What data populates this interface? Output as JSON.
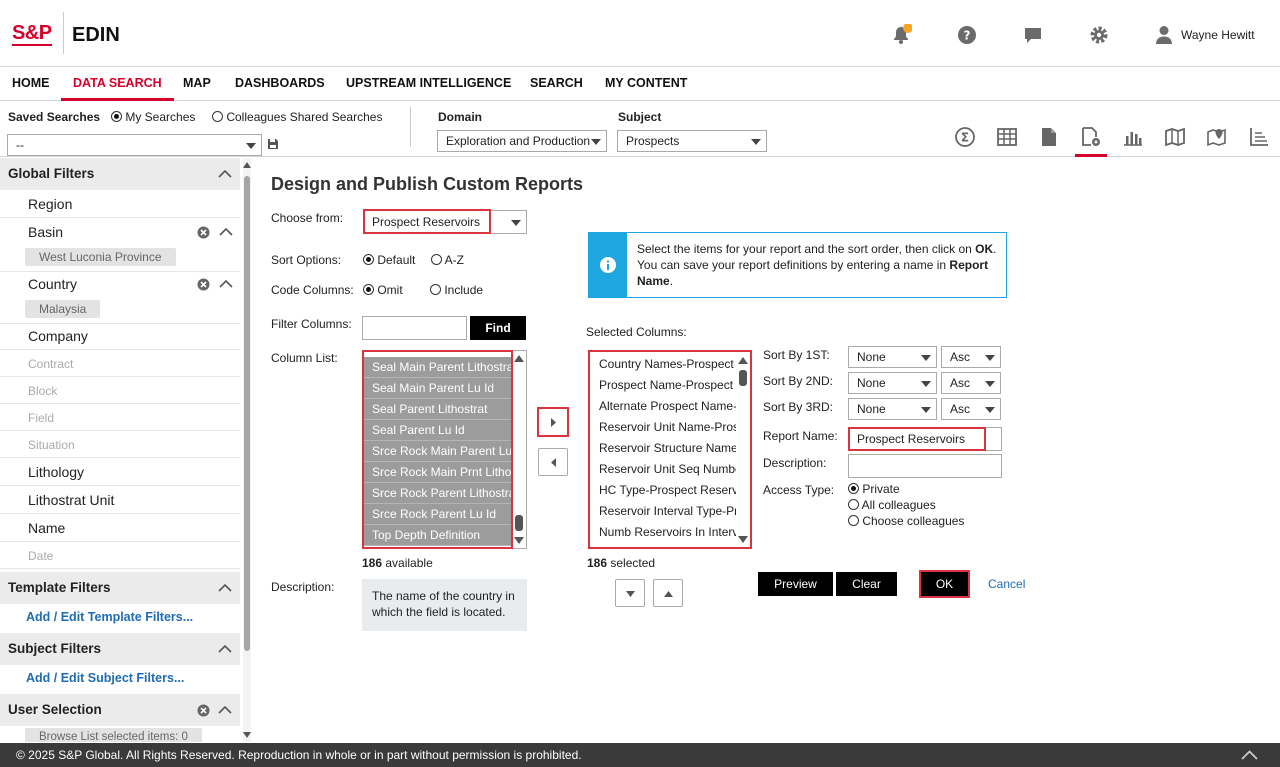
{
  "header": {
    "logo": "S&P",
    "app_name": "EDIN",
    "user_name": "Wayne Hewitt",
    "accent": "#d6002a",
    "notification_dot_color": "#f5a623"
  },
  "nav": {
    "items": [
      "HOME",
      "DATA SEARCH",
      "MAP",
      "DASHBOARDS",
      "UPSTREAM INTELLIGENCE",
      "SEARCH",
      "MY CONTENT"
    ],
    "active": "DATA SEARCH"
  },
  "toolbar": {
    "saved_searches_label": "Saved Searches",
    "my_searches": "My Searches",
    "colleagues_shared": "Colleagues Shared Searches",
    "saved_value": "--",
    "domain_label": "Domain",
    "domain_value": "Exploration and Production",
    "subject_label": "Subject",
    "subject_value": "Prospects"
  },
  "sidebar": {
    "global_filters": "Global Filters",
    "region": "Region",
    "basin": "Basin",
    "basin_chip": "West Luconia Province",
    "country": "Country",
    "country_chip": "Malaysia",
    "company": "Company",
    "contract": "Contract",
    "block": "Block",
    "field": "Field",
    "situation": "Situation",
    "lithology": "Lithology",
    "lithostrat_unit": "Lithostrat Unit",
    "name": "Name",
    "date": "Date",
    "template_filters": "Template Filters",
    "template_link": "Add / Edit Template Filters...",
    "subject_filters": "Subject Filters",
    "subject_link": "Add / Edit Subject Filters...",
    "user_selection": "User Selection",
    "browse_chip": "Browse List selected items: 0"
  },
  "main": {
    "title": "Design and Publish Custom Reports",
    "choose_from_label": "Choose from:",
    "choose_from_value": "Prospect Reservoirs",
    "sort_options_label": "Sort Options:",
    "sort_default": "Default",
    "sort_az": "A-Z",
    "code_columns_label": "Code Columns:",
    "code_omit": "Omit",
    "code_include": "Include",
    "filter_columns_label": "Filter Columns:",
    "find_button": "Find",
    "column_list_label": "Column List:",
    "column_list": [
      "Seal Main Parent Lithostrat",
      "Seal Main Parent Lu Id",
      "Seal Parent Lithostrat",
      "Seal Parent Lu Id",
      "Srce Rock Main Parent Lu Id",
      "Srce Rock Main Prnt Lithostrat",
      "Srce Rock Parent Lithostrat",
      "Srce Rock Parent Lu Id",
      "Top Depth Definition"
    ],
    "available_count": "186",
    "available_text": "available",
    "description_label": "Description:",
    "description_text": "The name of the country in which the field is located.",
    "info_text_1": "Select the items for your report and the sort order, then click on ",
    "info_ok": "OK",
    "info_text_2": ". You can save your report definitions by entering a name in ",
    "info_report_name": "Report Name",
    "info_text_3": ".",
    "selected_columns_label": "Selected Columns:",
    "selected_columns": [
      "Country Names-Prospect",
      "Prospect Name-Prospect",
      "Alternate Prospect Name-Prospect",
      "Reservoir Unit Name-Prospect",
      "Reservoir Structure Name",
      "Reservoir Unit Seq Number",
      "HC Type-Prospect Reservoir",
      "Reservoir Interval Type-Prospect",
      "Numb Reservoirs In Interval"
    ],
    "selected_count": "186",
    "selected_text": "selected",
    "sort_by_1": "Sort By 1ST:",
    "sort_by_2": "Sort By 2ND:",
    "sort_by_3": "Sort By 3RD:",
    "sort_none": "None",
    "sort_asc": "Asc",
    "report_name_label": "Report Name:",
    "report_name_value": "Prospect Reservoirs",
    "description2_label": "Description:",
    "access_type_label": "Access Type:",
    "access_private": "Private",
    "access_all": "All colleagues",
    "access_choose": "Choose colleagues",
    "preview_button": "Preview",
    "clear_button": "Clear",
    "ok_button": "OK",
    "cancel_link": "Cancel"
  },
  "footer": {
    "text": "© 2025 S&P Global. All Rights Reserved. Reproduction in whole or in part without permission is prohibited."
  }
}
